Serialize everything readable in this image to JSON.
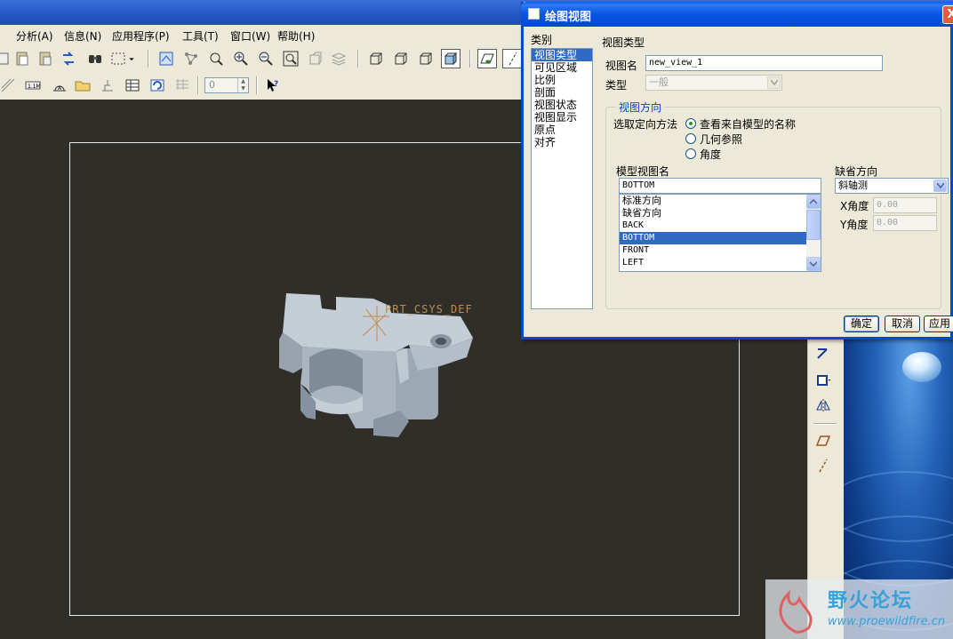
{
  "menu": {
    "items": [
      {
        "label": "）"
      },
      {
        "label": "分析(A)"
      },
      {
        "label": "信息(N)"
      },
      {
        "label": "应用程序(P)"
      },
      {
        "label": "工具(T)"
      },
      {
        "label": "窗口(W)"
      },
      {
        "label": "帮助(H)"
      }
    ]
  },
  "toolbar2": {
    "spin_value": "0"
  },
  "canvas": {
    "csys_label": "PRT_CSYS_DEF",
    "background": "#302e29",
    "sheet_border": "#e9e9e9"
  },
  "dialog": {
    "title": "绘图视图",
    "close_glyph": "X",
    "category_header": "类别",
    "categories": [
      "视图类型",
      "可见区域",
      "比例",
      "剖面",
      "视图状态",
      "视图显示",
      "原点",
      "对齐"
    ],
    "section_title": "视图类型",
    "view_name_label": "视图名",
    "view_name_value": "new_view_1",
    "type_label": "类型",
    "type_value": "一般",
    "orientation_group": "视图方向",
    "orientation_method_label": "选取定向方法",
    "radio_options": [
      "查看来自模型的名称",
      "几何参照",
      "角度"
    ],
    "model_view_names_label": "模型视图名",
    "model_view_name_value": "BOTTOM",
    "model_views": [
      "标准方向",
      "缺省方向",
      "BACK",
      "BOTTOM",
      "FRONT",
      "LEFT"
    ],
    "default_orientation_label": "缺省方向",
    "default_orientation_value": "斜轴测",
    "x_angle_label": "X角度",
    "x_angle_value": "0.00",
    "y_angle_label": "Y角度",
    "y_angle_value": "0.00",
    "ok_label": "确定",
    "cancel_label": "取消",
    "apply_label": "应用"
  },
  "watermark": {
    "title": "野火论坛",
    "url": "www.proewildfire.cn"
  },
  "colors": {
    "accent": "#316ac5",
    "titlebar": "#0a5ef2",
    "panel": "#ece9d8"
  }
}
